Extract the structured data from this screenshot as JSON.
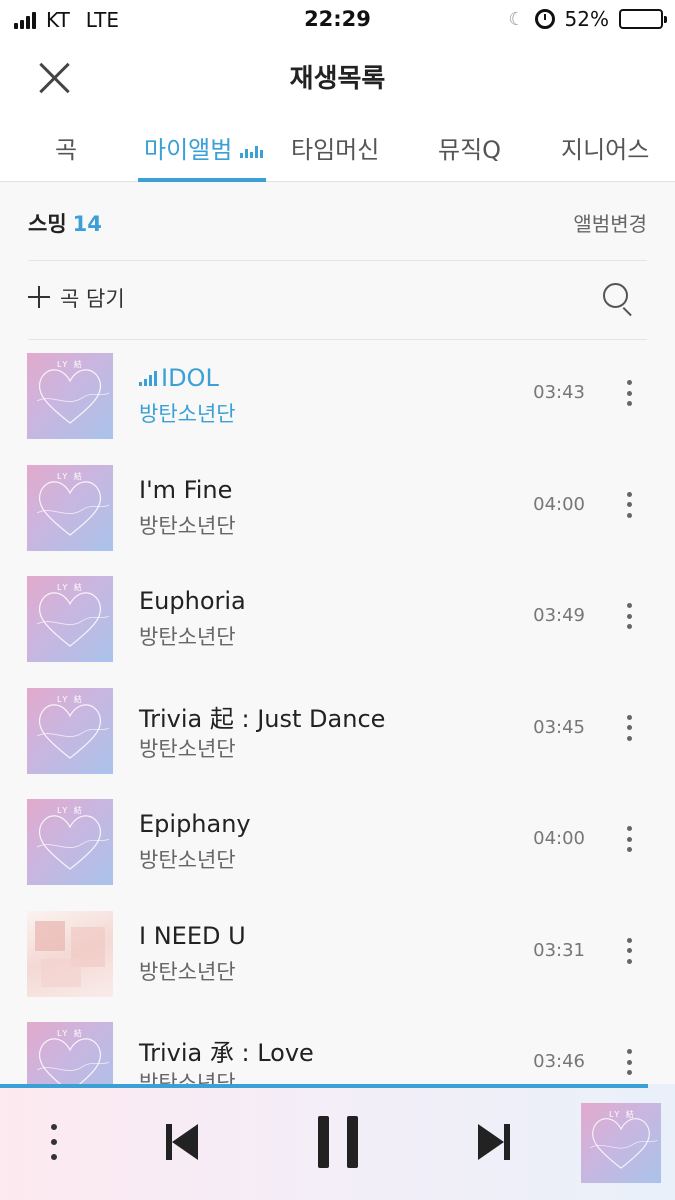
{
  "status_bar": {
    "carrier": "KT",
    "network": "LTE",
    "time": "22:29",
    "battery_percent": "52%",
    "battery_level": 0.52
  },
  "header": {
    "title": "재생목록",
    "close_icon": "close-icon"
  },
  "tabs": [
    {
      "label": "곡"
    },
    {
      "label": "마이앨범"
    },
    {
      "label": "타임머신"
    },
    {
      "label": "뮤직Q"
    },
    {
      "label": "지니어스"
    }
  ],
  "active_tab_index": 1,
  "album": {
    "name": "스밍",
    "count": "14",
    "change_label": "앨범변경"
  },
  "add_song": {
    "label": "곡 담기",
    "plus_icon": "plus-icon",
    "search_icon": "search-icon"
  },
  "songs": [
    {
      "title": "IDOL",
      "artist": "방탄소년단",
      "duration": "03:43",
      "playing": true,
      "cover": "love-yourself-answer"
    },
    {
      "title": "I'm Fine",
      "artist": "방탄소년단",
      "duration": "04:00",
      "playing": false,
      "cover": "love-yourself-answer"
    },
    {
      "title": "Euphoria",
      "artist": "방탄소년단",
      "duration": "03:49",
      "playing": false,
      "cover": "love-yourself-answer"
    },
    {
      "title": "Trivia 起 : Just Dance",
      "artist": "방탄소년단",
      "duration": "03:45",
      "playing": false,
      "cover": "love-yourself-answer"
    },
    {
      "title": "Epiphany",
      "artist": "방탄소년단",
      "duration": "04:00",
      "playing": false,
      "cover": "love-yourself-answer"
    },
    {
      "title": "I NEED U",
      "artist": "방탄소년단",
      "duration": "03:31",
      "playing": false,
      "cover": "the-most-beautiful-moment"
    },
    {
      "title": "Trivia 承 : Love",
      "artist": "방탄소년단",
      "duration": "03:46",
      "playing": false,
      "cover": "love-yourself-answer"
    }
  ],
  "player": {
    "progress": 0.96,
    "icons": [
      "more-vertical-icon",
      "previous-icon",
      "pause-icon",
      "next-icon"
    ],
    "accent_color": "#3aa0d6"
  }
}
